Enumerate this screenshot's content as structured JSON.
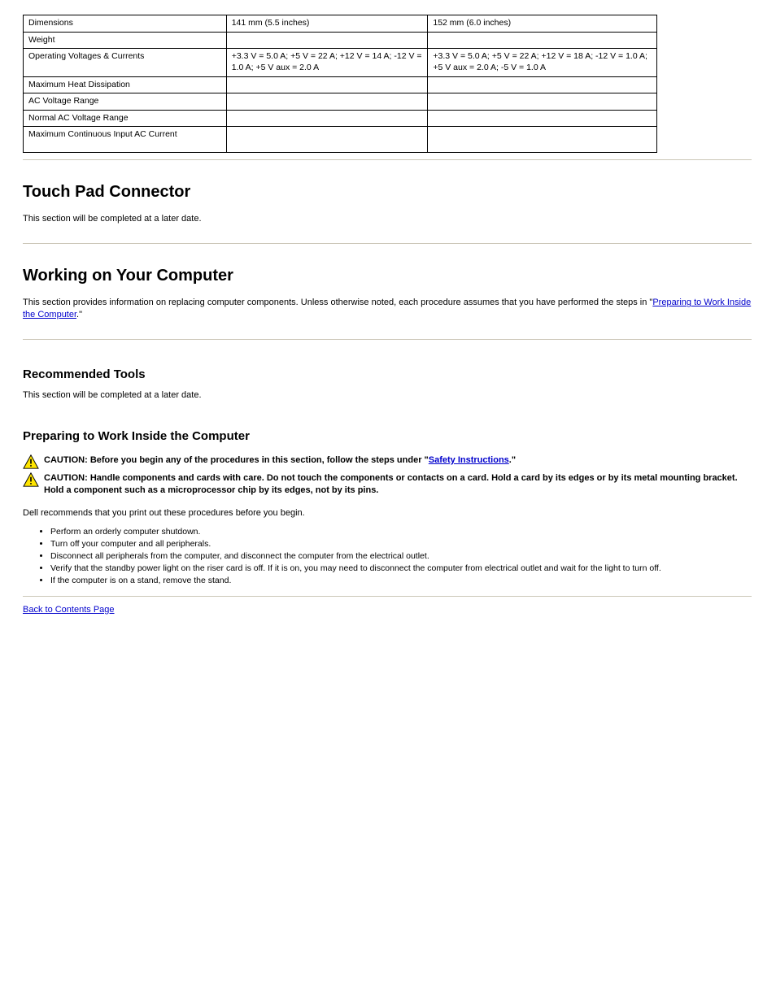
{
  "table": {
    "rows": [
      {
        "c1": "Dimensions",
        "c2": "141 mm (5.5 inches)",
        "c3": "152 mm (6.0 inches)"
      },
      {
        "c1": "Weight",
        "c2": "",
        "c3": ""
      },
      {
        "c1": "Operating Voltages & Currents",
        "c2": "+3.3 V = 5.0 A; +5 V = 22 A; +12 V = 14 A; -12 V = 1.0 A; +5 V aux = 2.0 A",
        "c3": "+3.3 V = 5.0 A; +5 V = 22 A; +12 V = 18 A; -12 V = 1.0 A; +5 V aux = 2.0 A; -5 V = 1.0 A"
      },
      {
        "c1": "Maximum Heat Dissipation",
        "c2": "",
        "c3": ""
      },
      {
        "c1": "AC Voltage Range",
        "c2": "",
        "c3": ""
      },
      {
        "c1": "Normal AC Voltage Range",
        "c2": "",
        "c3": ""
      },
      {
        "c1": "Maximum Continuous Input  AC Current",
        "c2": "",
        "c3": ""
      }
    ]
  },
  "sections": {
    "touchpad": {
      "title": "Touch Pad Connector",
      "body": "This section will be completed at a later date."
    },
    "working": {
      "title": "Working on Your Computer",
      "body": "This section provides information on replacing computer components. Unless otherwise noted, each procedure assumes that  you have performed the steps in \"",
      "body_link": "Preparing to Work Inside the Computer",
      "body_after": ".\""
    },
    "tools": {
      "title": "Recommended Tools",
      "body": "This section will be completed at a later date."
    },
    "preparing": {
      "title": "Preparing to Work Inside the Computer",
      "caution1_prefix": "CAUTION: Before you begin any of the procedures in this section, follow the steps under \"",
      "caution1_link": "Safety Instructions",
      "caution1_suffix": ".\"",
      "caution2": "CAUTION: Handle components and cards with care. Do not touch  the components or contacts on a card. Hold a card by its edges or by its metal mounting bracket. Hold a component such as a microprocessor chip  by its edges, not by its pins.",
      "recommend": "Dell recommends that you print out these procedures before you begin.",
      "items": [
        "Perform an orderly computer shutdown.",
        "Turn off your computer and all peripherals.",
        "Disconnect all peripherals from the computer, and disconnect the computer from the electrical outlet.",
        "Verify that the standby power light on the riser card is off. If it is on, you may need to disconnect the computer from electrical outlet and wait for the light to  turn off.",
        "If the computer is on a stand, remove the stand."
      ]
    },
    "back_link": "Back to Contents Page"
  }
}
